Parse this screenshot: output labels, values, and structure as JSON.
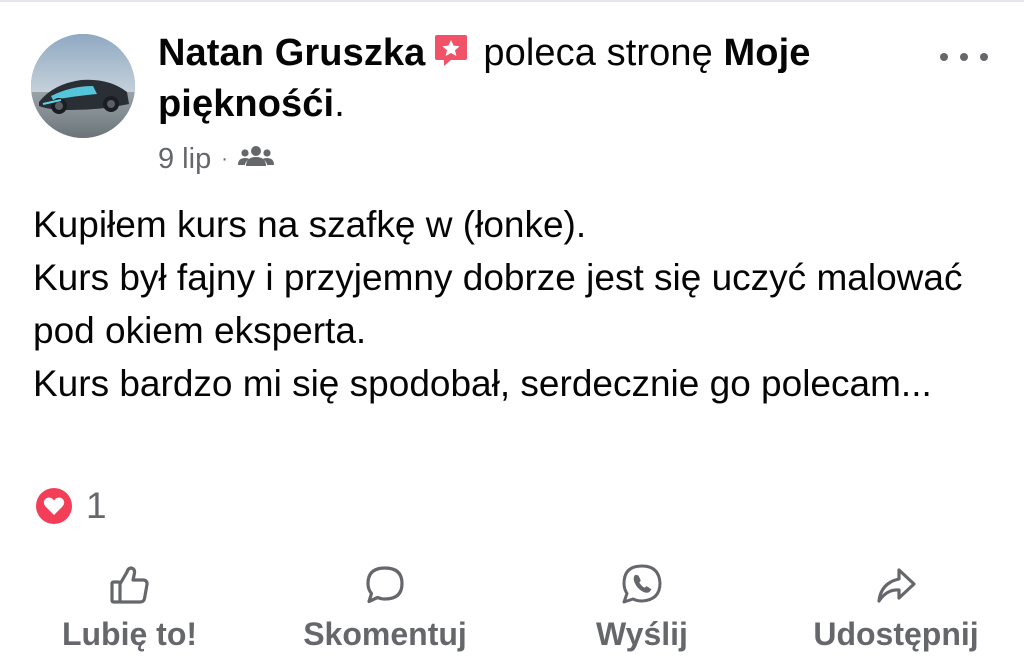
{
  "post": {
    "author_name": "Natan Gruszka",
    "action_text": "poleca stronę",
    "page_name": "Moje pięknośći",
    "page_name_suffix": ".",
    "date": "9 lip",
    "separator": "·",
    "audience_icon": "friends-icon",
    "author_badge_icon": "recommendation-star-icon",
    "more_icon": "more-horizontal-icon",
    "body": "Kupiłem kurs na szafkę w (łonke).\nKurs był fajny i przyjemny dobrze jest się uczyć malować pod okiem eksperta.\nKurs bardzo mi się spodobał, serdecznie go polecam..."
  },
  "reactions": {
    "icon": "heart-reaction-icon",
    "count": "1"
  },
  "actions": {
    "like": {
      "label": "Lubię to!",
      "icon": "thumbs-up-icon"
    },
    "comment": {
      "label": "Skomentuj",
      "icon": "comment-bubble-icon"
    },
    "send": {
      "label": "Wyślij",
      "icon": "whatsapp-icon"
    },
    "share": {
      "label": "Udostępnij",
      "icon": "share-arrow-icon"
    }
  },
  "colors": {
    "text_primary": "#050505",
    "text_secondary": "#65676b",
    "badge_red": "#f25268",
    "heart_red": "#f33e58",
    "background": "#ffffff"
  }
}
